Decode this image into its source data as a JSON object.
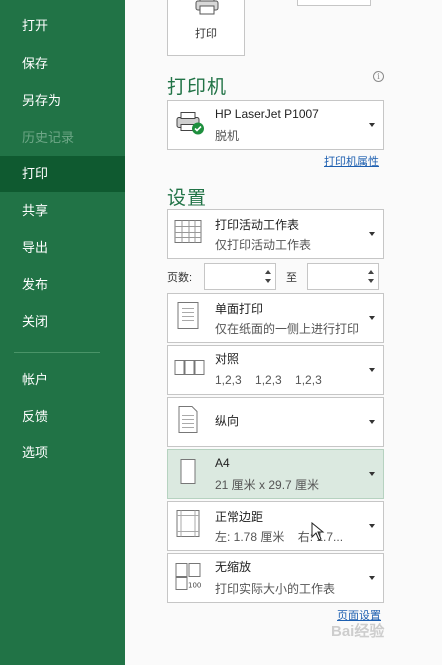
{
  "sidebar": {
    "items": [
      {
        "label": "打开"
      },
      {
        "label": "保存"
      },
      {
        "label": "另存为"
      },
      {
        "label": "历史记录"
      },
      {
        "label": "打印"
      },
      {
        "label": "共享"
      },
      {
        "label": "导出"
      },
      {
        "label": "发布"
      },
      {
        "label": "关闭"
      },
      {
        "label": "帐户"
      },
      {
        "label": "反馈"
      },
      {
        "label": "选项"
      }
    ],
    "active": "打印"
  },
  "print_button": {
    "label": "打印"
  },
  "printer": {
    "section_title": "打印机",
    "name": "HP LaserJet P1007",
    "status": "脱机",
    "properties_link": "打印机属性"
  },
  "settings": {
    "section_title": "设置",
    "what": {
      "title": "打印活动工作表",
      "subtitle": "仅打印活动工作表"
    },
    "pages_label": "页数:",
    "to_label": "至",
    "pages_from": "",
    "pages_to": "",
    "sides": {
      "title": "单面打印",
      "subtitle": "仅在纸面的一侧上进行打印"
    },
    "collate": {
      "title": "对照",
      "subtitle": "1,2,3    1,2,3    1,2,3"
    },
    "orientation": {
      "title": "纵向"
    },
    "paper": {
      "title": "A4",
      "subtitle": "21 厘米 x 29.7 厘米"
    },
    "margins": {
      "title": "正常边距",
      "subtitle": "左: 1.78 厘米    右: 1.7..."
    },
    "scaling": {
      "title": "无缩放",
      "subtitle": "打印实际大小的工作表"
    },
    "page_setup_link": "页面设置"
  },
  "watermark": "Bai经验",
  "colors": {
    "accent": "#217346",
    "active_nav": "#0f5a30",
    "selected": "#dbe9e0",
    "link": "#1d5fb0"
  }
}
